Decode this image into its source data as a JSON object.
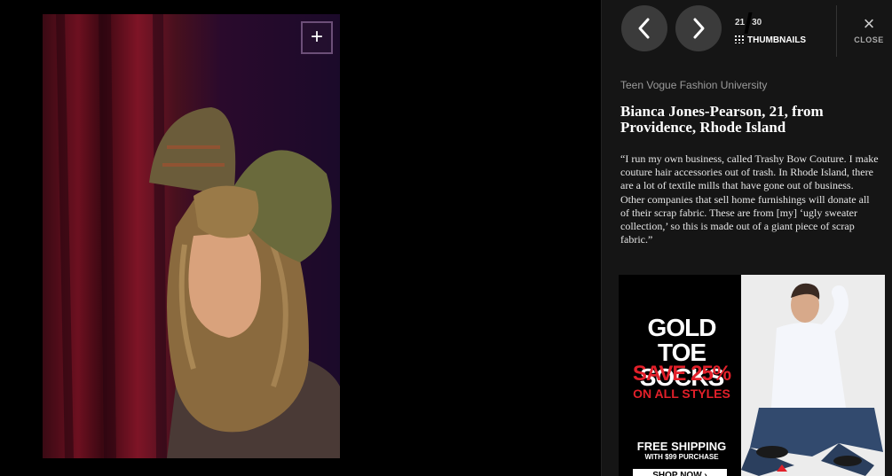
{
  "gallery": {
    "zoom_label": "+",
    "photo_alt": "Woman wearing a large fabric bow headpiece in front of a red curtain"
  },
  "nav": {
    "prev_icon": "chevron-left-icon",
    "next_icon": "chevron-right-icon",
    "current": "21",
    "total": "30",
    "thumbnails_label": "THUMBNAILS",
    "close_icon": "×",
    "close_label": "CLOSE"
  },
  "caption": {
    "section": "Teen Vogue Fashion University",
    "title": "Bianca Jones-Pearson, 21, from Providence, Rhode Island",
    "body": "“I run my own business, called Trashy Bow Couture. I make couture hair accessories out of trash. In Rhode Island, there are a lot of textile mills that have gone out of business. Other companies that sell home furnishings will donate all of their scrap fabric. These are from [my] ‘ugly sweater collection,’ so this is made out of a giant piece of scrap fabric.”"
  },
  "ad": {
    "headline1": "GOLD TOE SOCKS",
    "headline2": "SAVE 25%",
    "headline3": "ON ALL STYLES",
    "shipping": "FREE SHIPPING",
    "shipping_note": "WITH $99 PURCHASE",
    "cta": "SHOP NOW ›"
  },
  "colors": {
    "accent_red": "#e2202a",
    "panel_bg": "#151515",
    "nav_btn": "#3b3b3b"
  }
}
